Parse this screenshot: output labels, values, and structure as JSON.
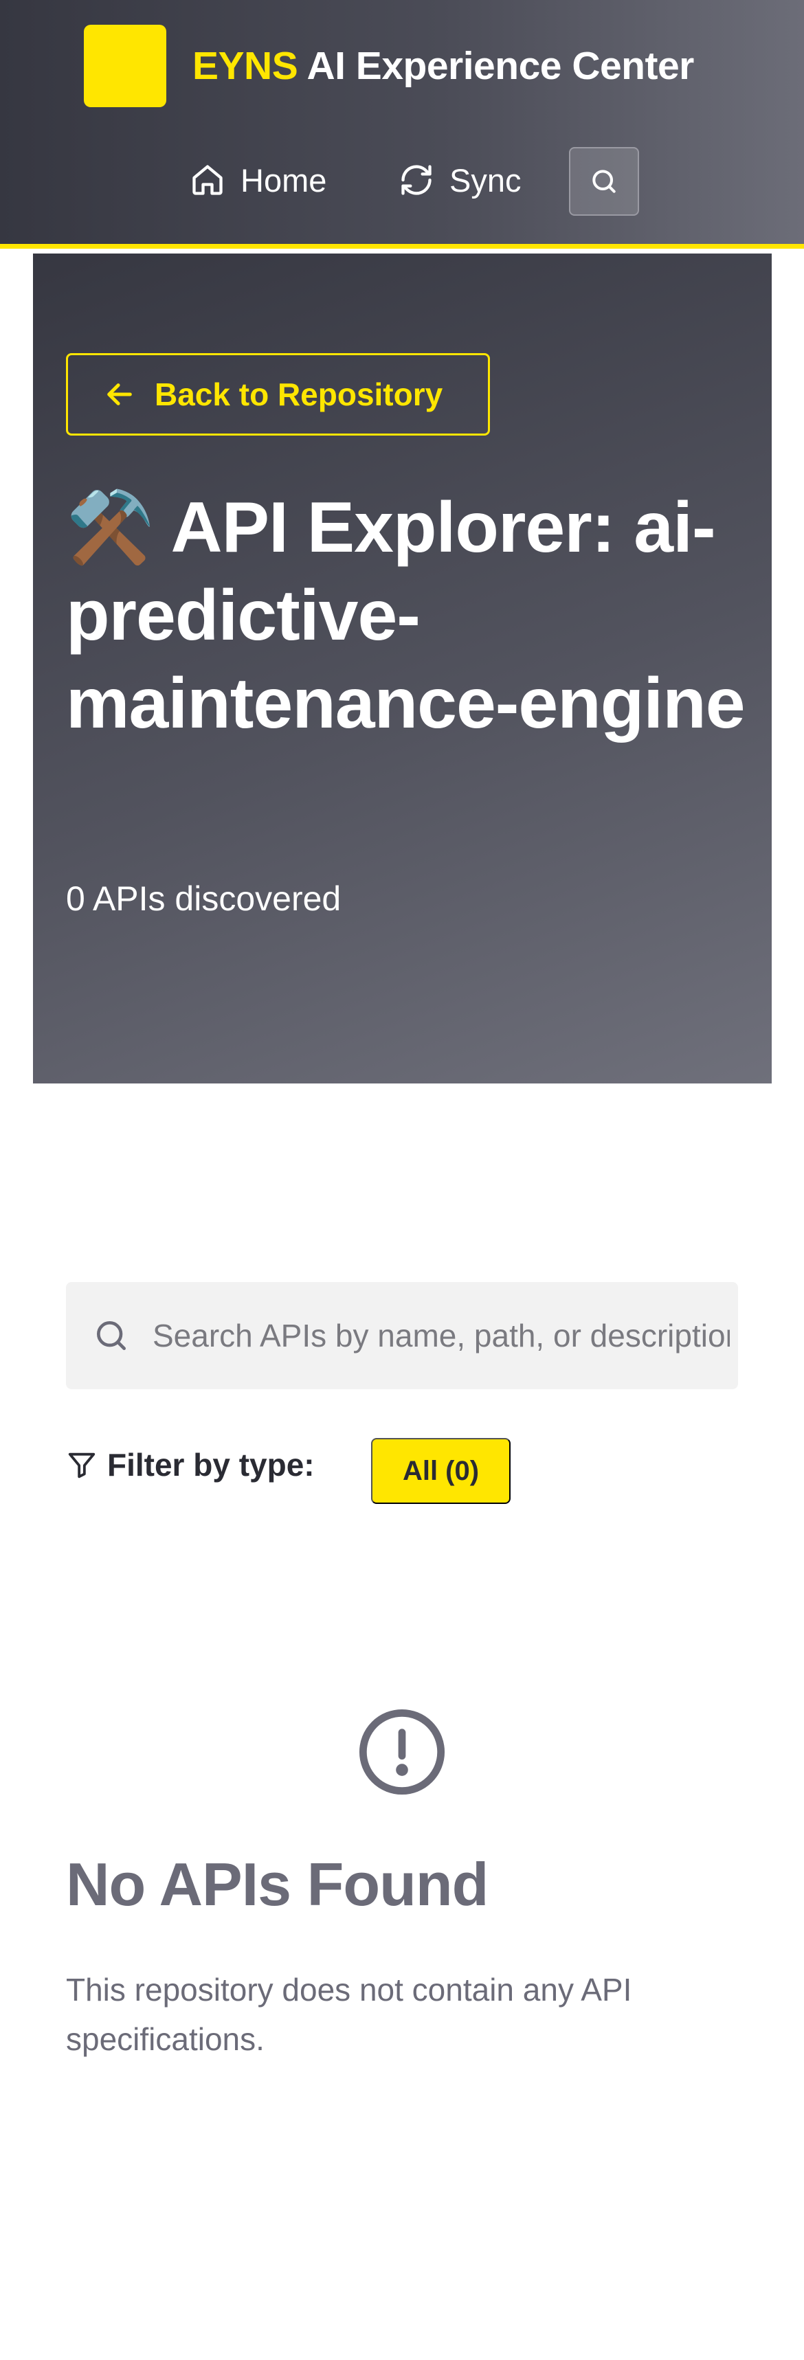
{
  "header": {
    "brand_accent": "EYNS",
    "brand_rest": "AI Experience Center",
    "nav": {
      "home_label": "Home",
      "sync_label": "Sync"
    }
  },
  "hero": {
    "back_label": "Back to Repository",
    "title": "⚒️ API Explorer: ai-predictive-maintenance-engine",
    "subtitle": "0 APIs discovered"
  },
  "search": {
    "placeholder": "Search APIs by name, path, or description...",
    "value": ""
  },
  "filter": {
    "label": "Filter by type:",
    "chips": [
      {
        "label": "All (0)",
        "active": true
      }
    ]
  },
  "empty_state": {
    "title": "No APIs Found",
    "description": "This repository does not contain any API specifications."
  },
  "icons": {
    "logo": "logo-icon",
    "home": "home-icon",
    "sync": "sync-icon",
    "search": "search-icon",
    "back": "arrow-left-icon",
    "filter": "filter-icon",
    "empty": "alert-circle-icon"
  },
  "colors": {
    "accent": "#ffe600",
    "header_bg": "#4b4c57",
    "muted_text": "#6b6b78"
  }
}
